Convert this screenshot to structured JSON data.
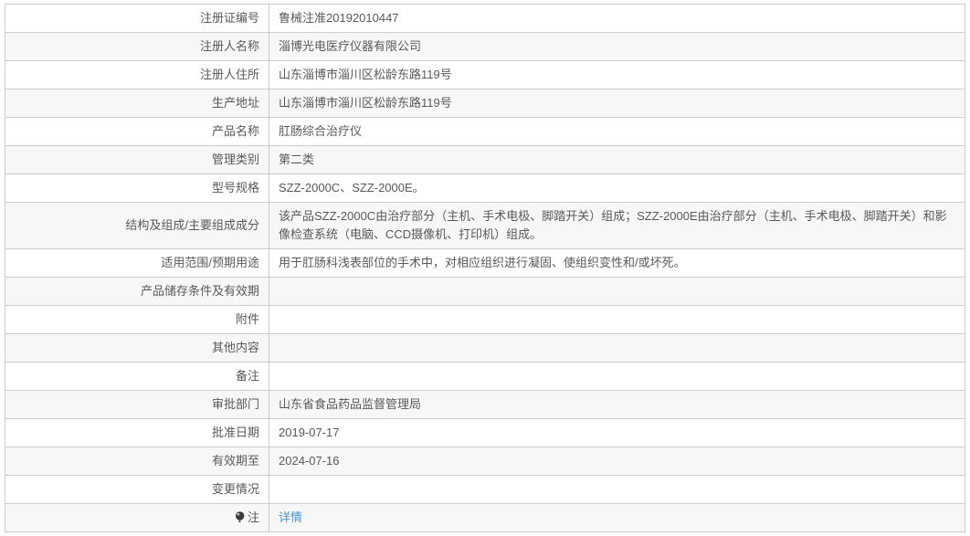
{
  "page_title": "医疗器械注册证详情",
  "colors": {
    "link_blue": "#4a90d9",
    "row_alt_background": "#f7f7f7",
    "border_gray": "#cccccc",
    "text_gray": "#595959",
    "note_icon_dark": "#3a3a3a"
  },
  "icons": {
    "note_icon": "note-balloon-icon"
  },
  "table": {
    "rows": [
      {
        "label": "注册证编号",
        "value": "鲁械注准20192010447"
      },
      {
        "label": "注册人名称",
        "value": "淄博光电医疗仪器有限公司"
      },
      {
        "label": "注册人住所",
        "value": "山东淄博市淄川区松龄东路119号"
      },
      {
        "label": "生产地址",
        "value": "山东淄博市淄川区松龄东路119号"
      },
      {
        "label": "产品名称",
        "value": "肛肠综合治疗仪"
      },
      {
        "label": "管理类别",
        "value": "第二类"
      },
      {
        "label": "型号规格",
        "value": "SZZ-2000C、SZZ-2000E。"
      },
      {
        "label": "结构及组成/主要组成成分",
        "value": "该产品SZZ-2000C由治疗部分（主机、手术电极、脚踏开关）组成；SZZ-2000E由治疗部分（主机、手术电极、脚踏开关）和影像检查系统（电脑、CCD摄像机、打印机）组成。"
      },
      {
        "label": "适用范围/预期用途",
        "value": "用于肛肠科浅表部位的手术中，对相应组织进行凝固、使组织变性和/或坏死。"
      },
      {
        "label": "产品储存条件及有效期",
        "value": ""
      },
      {
        "label": "附件",
        "value": ""
      },
      {
        "label": "其他内容",
        "value": ""
      },
      {
        "label": "备注",
        "value": ""
      },
      {
        "label": "审批部门",
        "value": "山东省食品药品监督管理局"
      },
      {
        "label": "批准日期",
        "value": "2019-07-17"
      },
      {
        "label": "有效期至",
        "value": "2024-07-16"
      },
      {
        "label": "变更情况",
        "value": ""
      },
      {
        "label": "注",
        "value": "详情",
        "link": true,
        "icon": true
      }
    ]
  }
}
